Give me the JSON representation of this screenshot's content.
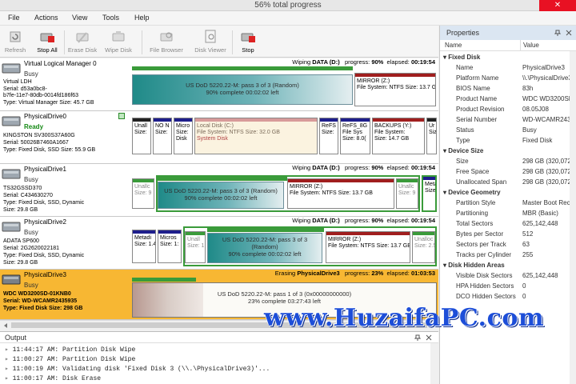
{
  "window": {
    "title": "56% total progress",
    "close_glyph": "✕"
  },
  "menu": [
    "File",
    "Actions",
    "View",
    "Tools",
    "Help"
  ],
  "toolbar": {
    "refresh": "Refresh",
    "stop_all": "Stop All",
    "erase_disk": "Erase Disk",
    "wipe_disk": "Wipe Disk",
    "file_browser": "File Browser",
    "disk_viewer": "Disk Viewer",
    "stop": "Stop"
  },
  "drives": [
    {
      "name": "Virtual Logical Manager 0",
      "status": "Busy",
      "l1": "Virtual LDH",
      "l2": "Serial: d53a0bc8-",
      "l3": "b7fe-11e7-80db-0014fd186f63",
      "l4": "Type: Virtual Manager  Size: 45.7 GB",
      "header": {
        "action": "Wiping",
        "target": "DATA (D:)",
        "progress_label": "progress:",
        "progress": "90%",
        "elapsed_label": "elapsed:",
        "elapsed": "00:19:54"
      },
      "wipe_l1": "US DoD 5220.22-M: pass 3 of 3 (Random)",
      "wipe_l2": "90% complete    00:02:02 left",
      "mirror_l1": "MIRROR (Z:)",
      "mirror_l2": "File System: NTFS Size: 13.7 GB"
    },
    {
      "name": "PhysicalDrive0",
      "status": "Ready",
      "l1": "KINGSTON SV300S37A60G",
      "l2": "Serial: 50026B7460A1667",
      "l3": "Type: Fixed Disk, SSD  Size: 55.9 GB",
      "p1a": "Unall",
      "p1b": "Size:",
      "p2a": "NO N",
      "p2b": "Size:",
      "p3a": "Micro",
      "p3b": "Size:",
      "p3c": "Disk",
      "local_l1": "Local Disk (C:)",
      "local_l2": "File System: NTFS Size: 32.0 GB",
      "local_l3": "System Disk",
      "p5a": "ReFS",
      "p5b": "Size:",
      "p6a": "ReFS_8G",
      "p6b": "File Sys",
      "p6c": "Size: 8.0(",
      "backups_l1": "BACKUPS (Y:)",
      "backups_l2": "File System:",
      "backups_l3": "Size: 14.7 GB",
      "p8a": "Ur",
      "p8b": "Siz"
    },
    {
      "name": "PhysicalDrive1",
      "status": "Busy",
      "l1": "TS32GSSD370",
      "l2": "Serial: C434630270",
      "l3": "Type: Fixed Disk, SSD, Dynamic",
      "l4": "Size: 29.8 GB",
      "header": {
        "action": "Wiping",
        "target": "DATA (D:)",
        "progress_label": "progress:",
        "progress": "90%",
        "elapsed_label": "elapsed:",
        "elapsed": "00:19:54"
      },
      "u1a": "Unallc",
      "u1b": "Size: 9",
      "wipe_l1": "US DoD 5220.22-M: pass 3 of 3 (Random)",
      "wipe_l2": "90% complete    00:02:02 left",
      "mirror_l1": "MIRROR (Z:)",
      "mirror_l2": "File System: NTFS Size: 13.7 GB",
      "u2a": "Unallc",
      "u2b": "Size: 9",
      "m1a": "Meta",
      "m1b": "Size"
    },
    {
      "name": "PhysicalDrive2",
      "status": "Busy",
      "l1": "ADATA SP600",
      "l2": "Serial: 2G2620022181",
      "l3": "Type: Fixed Disk, SSD, Dynamic",
      "l4": "Size: 29.8 GB",
      "header": {
        "action": "Wiping",
        "target": "DATA (D:)",
        "progress_label": "progress:",
        "progress": "90%",
        "elapsed_label": "elapsed:",
        "elapsed": "00:19:54"
      },
      "m1a": "Metadi",
      "m1b": "Size: 1.4",
      "m2a": "Micros",
      "m2b": "Size: 1:",
      "u1a": "Unall",
      "u1b": "Size: 1",
      "wipe_l1": "US DoD 5220.22-M: pass 3 of 3",
      "wipe_l2": "(Random)",
      "wipe_l3": "90% complete    00:02:02 left",
      "mirror_l1": "MIRROR (Z:)",
      "mirror_l2": "File System: NTFS Size: 13.7 GB",
      "u2a": "Unalloc",
      "u2b": "Size: 2.5"
    },
    {
      "name": "PhysicalDrive3",
      "status": "Busy",
      "l1": "WDC WD3200SD-01KNB0",
      "l2": "Serial: WD-WCAMR2435935",
      "l3": "Type: Fixed Disk  Size: 298 GB",
      "header": {
        "action": "Erasing",
        "target": "PhysicalDrive3",
        "progress_label": "progress:",
        "progress": "23%",
        "elapsed_label": "elapsed:",
        "elapsed": "01:03:53"
      },
      "erase_l1": "US DoD 5220.22-M: pass 1 of 3 (0x00000000000)",
      "erase_l2": "23% complete    03:27:43 left"
    }
  ],
  "output": {
    "title": "Output",
    "lines": [
      "11:44:17 AM: Partition Disk Wipe",
      "11:00:27 AM: Partition Disk Wipe",
      "11:00:19 AM: Validating disk 'Fixed Disk 3 (\\\\.\\PhysicalDrive3)'...",
      "11:00:17 AM: Disk Erase"
    ]
  },
  "properties": {
    "title": "Properties",
    "col_name": "Name",
    "col_value": "Value",
    "sections": [
      {
        "title": "Fixed Disk",
        "rows": [
          [
            "Name",
            "PhysicalDrive3"
          ],
          [
            "Platform Name",
            "\\\\.\\PhysicalDrive3"
          ],
          [
            "BIOS Name",
            "83h"
          ],
          [
            "Product Name",
            "WDC WD3200SD-01"
          ],
          [
            "Product Revision",
            "08.05J08"
          ],
          [
            "Serial Number",
            "WD-WCAMR2435"
          ],
          [
            "Status",
            "Busy"
          ],
          [
            "Type",
            "Fixed Disk"
          ]
        ]
      },
      {
        "title": "Device Size",
        "rows": [
          [
            "Size",
            "298 GB (320,072,9"
          ],
          [
            "Free Space",
            "298 GB (320,072,9"
          ],
          [
            "Unallocated Span",
            "298 GB (320,072,9"
          ]
        ]
      },
      {
        "title": "Device Geometry",
        "rows": [
          [
            "Partition Style",
            "Master Boot Reco"
          ],
          [
            "Partitioning",
            "MBR (Basic)"
          ],
          [
            "Total Sectors",
            "625,142,448"
          ],
          [
            "Bytes per Sector",
            "512"
          ],
          [
            "Sectors per Track",
            "63"
          ],
          [
            "Tracks per Cylinder",
            "255"
          ]
        ]
      },
      {
        "title": "Disk Hidden Areas",
        "rows": [
          [
            "Visible Disk Sectors",
            "625,142,448"
          ],
          [
            "HPA Hidden Sectors",
            "0"
          ],
          [
            "DCO Hidden Sectors",
            "0"
          ]
        ]
      }
    ]
  },
  "watermark": "www.HuzaifaPC.com",
  "colors": {
    "selected_row": "#f7b733",
    "progress_green": "#3a9b3a",
    "partition_stripe": "#1e1e8c",
    "mirror_stripe": "#a01e1e",
    "watermark": "#1d4ed8"
  }
}
